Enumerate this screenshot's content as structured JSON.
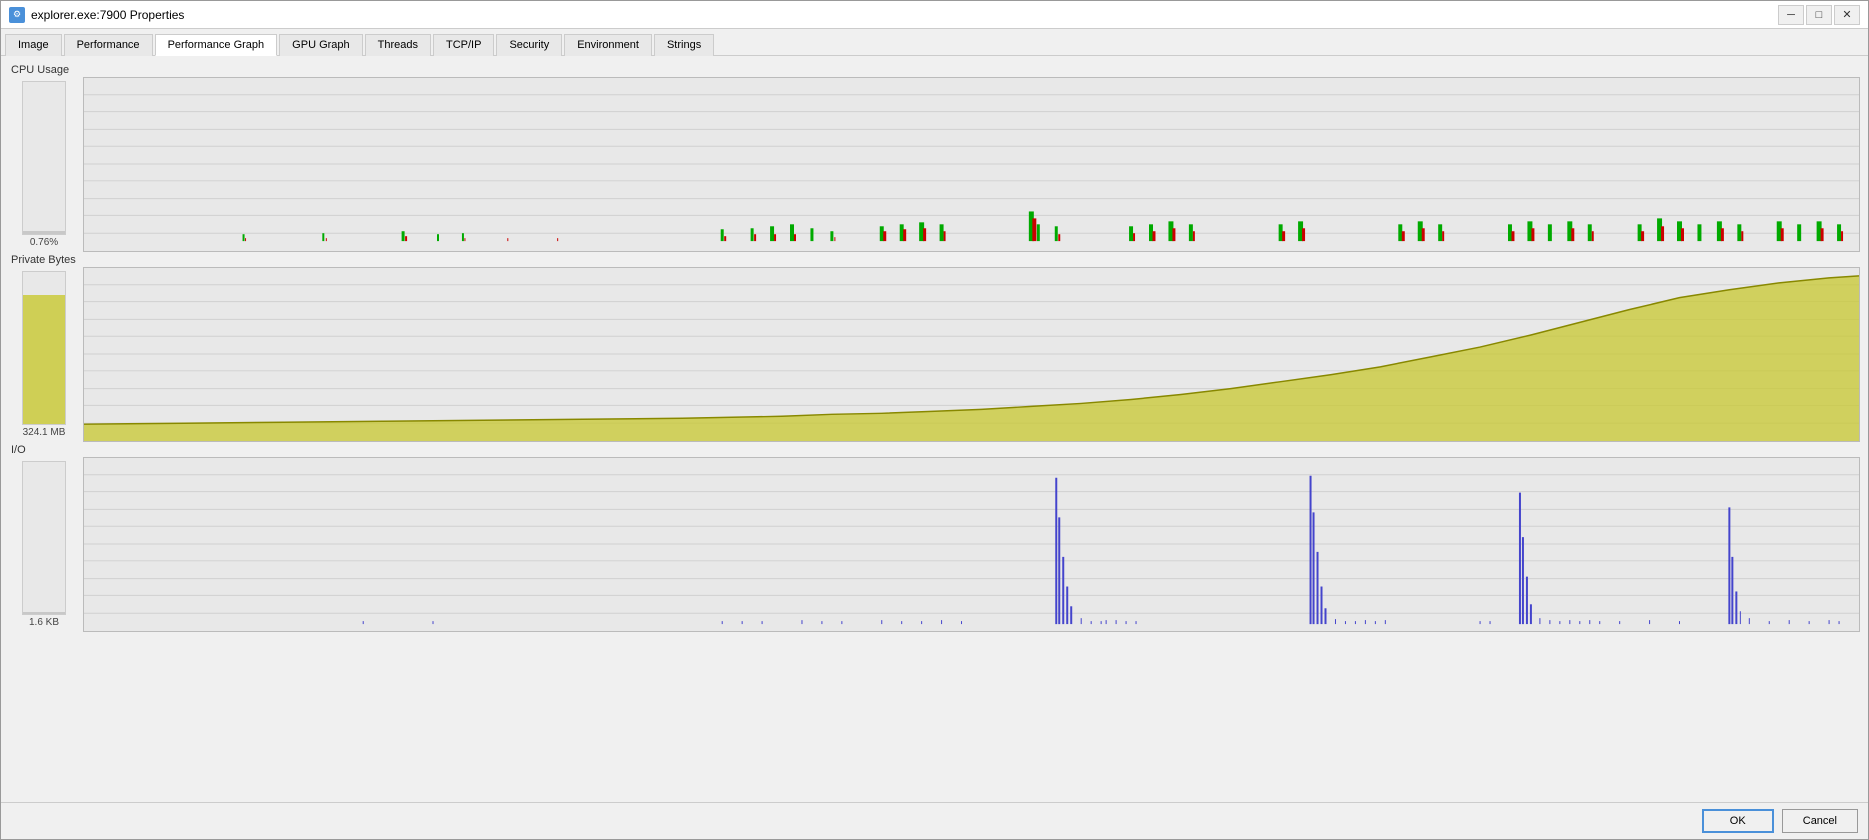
{
  "window": {
    "title": "explorer.exe:7900 Properties",
    "icon": "⚙"
  },
  "titlebar": {
    "minimize": "─",
    "maximize": "□",
    "close": "✕"
  },
  "tabs": [
    {
      "label": "Image",
      "active": false
    },
    {
      "label": "Performance",
      "active": false
    },
    {
      "label": "Performance Graph",
      "active": true
    },
    {
      "label": "GPU Graph",
      "active": false
    },
    {
      "label": "Threads",
      "active": false
    },
    {
      "label": "TCP/IP",
      "active": false
    },
    {
      "label": "Security",
      "active": false
    },
    {
      "label": "Environment",
      "active": false
    },
    {
      "label": "Strings",
      "active": false
    }
  ],
  "charts": {
    "cpu": {
      "label": "CPU Usage",
      "value": "0.76%"
    },
    "memory": {
      "label": "Private Bytes",
      "value": "324.1 MB"
    },
    "io": {
      "label": "I/O",
      "value": "1.6 KB"
    }
  },
  "footer": {
    "ok_label": "OK",
    "cancel_label": "Cancel"
  }
}
